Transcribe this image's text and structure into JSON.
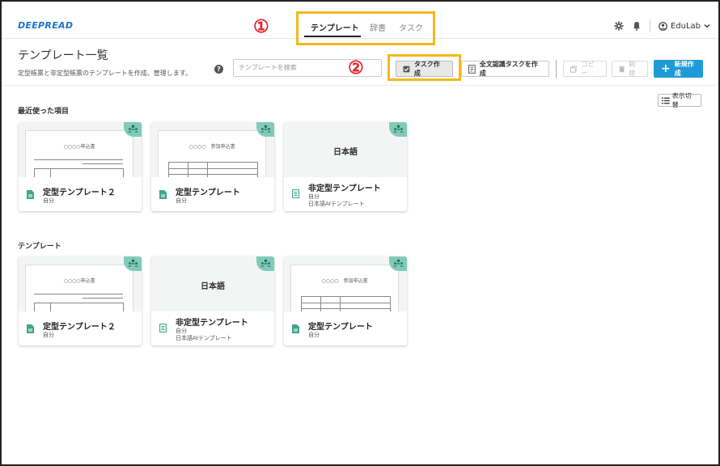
{
  "header": {
    "logo": "DEEPREAD",
    "tabs": [
      {
        "label": "テンプレート",
        "active": true
      },
      {
        "label": "辞書",
        "active": false
      },
      {
        "label": "タスク",
        "active": false
      }
    ],
    "user": "EduLab",
    "annotation_1": "①",
    "annotation_2": "②"
  },
  "page": {
    "title": "テンプレート一覧",
    "description": "定型帳票と非定型帳票のテンプレートを作成、管理します。",
    "help": "?",
    "search_placeholder": "テンプレートを検索"
  },
  "toolbar": {
    "task_create": "タスク作成",
    "fulltext_task": "全文認識タスクを作成",
    "copy": "コピー",
    "delete": "削除",
    "new": "新規作成",
    "view_toggle": "表示切替"
  },
  "sections": {
    "recent": "最近使った項目",
    "templates": "テンプレート"
  },
  "recent_cards": [
    {
      "name": "定型テンプレート２",
      "owner": "自分",
      "sub": "",
      "thumb": "form",
      "thumb_title": "○○○○申込書",
      "kind": "fixed"
    },
    {
      "name": "定型テンプレート",
      "owner": "自分",
      "sub": "",
      "thumb": "form2",
      "thumb_title": "○○○○　参加申込書",
      "kind": "fixed"
    },
    {
      "name": "非定型テンプレート",
      "owner": "自分",
      "sub": "日本語AIテンプレート",
      "thumb": "ja",
      "thumb_title": "日本語",
      "kind": "free"
    }
  ],
  "template_cards": [
    {
      "name": "定型テンプレート２",
      "owner": "自分",
      "sub": "",
      "thumb": "form",
      "thumb_title": "○○○○申込書",
      "kind": "fixed"
    },
    {
      "name": "非定型テンプレート",
      "owner": "自分",
      "sub": "日本語AIテンプレート",
      "thumb": "ja",
      "thumb_title": "日本語",
      "kind": "free"
    },
    {
      "name": "定型テンプレート",
      "owner": "自分",
      "sub": "",
      "thumb": "form2",
      "thumb_title": "○○○○　参加申込書",
      "kind": "fixed"
    }
  ],
  "colors": {
    "accent": "#1e9bd7",
    "logo": "#1a73c8",
    "highlight": "#f1b91b",
    "annotation": "#e8232d",
    "badge": "#7fcbb9",
    "fixed_icon": "#3aa88a",
    "free_icon": "#3aa88a"
  }
}
